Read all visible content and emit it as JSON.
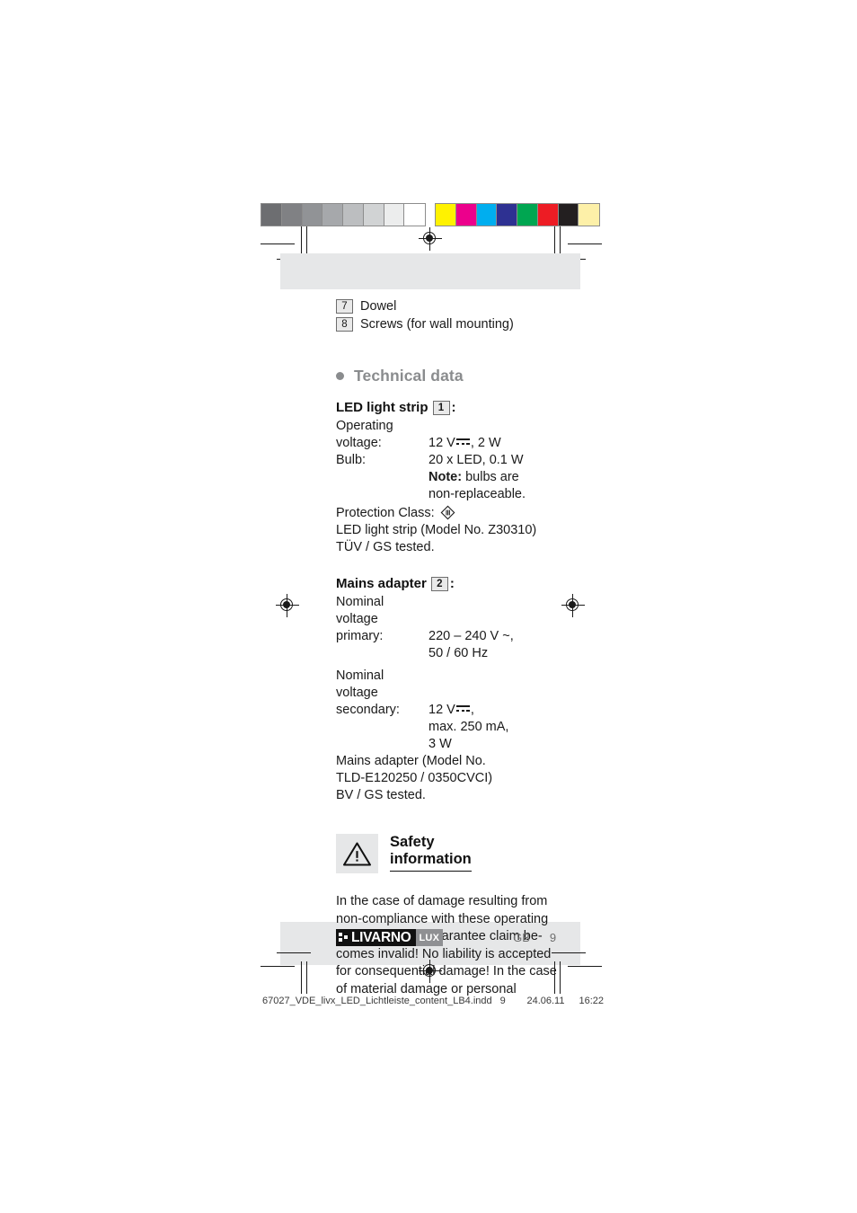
{
  "colorbars": {
    "gray": [
      "#6d6e71",
      "#808184",
      "#919396",
      "#a6a8ab",
      "#bcbec0",
      "#d1d3d4",
      "#eceded",
      "#ffffff"
    ],
    "process": [
      "#fff200",
      "#ec008c",
      "#00aeef",
      "#2e3192",
      "#00a651",
      "#ed1c24",
      "#231f20",
      "#fdf0a8"
    ]
  },
  "parts": [
    {
      "num": "7",
      "label": "Dowel"
    },
    {
      "num": "8",
      "label": "Screws (for wall mounting)"
    }
  ],
  "technical": {
    "heading": "Technical data",
    "led_strip": {
      "title": "LED light strip",
      "num": "1",
      "colon": ":",
      "rows": [
        {
          "label": "Operating",
          "value": ""
        },
        {
          "label": "voltage:",
          "value": "12 V",
          "value_suffix": ", 2 W",
          "dc": true
        },
        {
          "label": "Bulb:",
          "value": "20 x LED, 0.1 W"
        },
        {
          "label": "",
          "value_bold": "Note:",
          "value": " bulbs are"
        },
        {
          "label": "",
          "value": "non-replaceable."
        }
      ],
      "protection_label": "Protection Class:",
      "protection_symbol": "class-III",
      "model_line": "LED light strip (Model No. Z30310)",
      "tested_line": "TÜV / GS tested."
    },
    "mains_adapter": {
      "title": "Mains adapter",
      "num": "2",
      "colon": ":",
      "primary_label_1": "Nominal voltage",
      "primary_label_2": "primary:",
      "primary_value_1": "220 – 240 V ~,",
      "primary_value_2": "50 / 60 Hz",
      "secondary_label_1": "Nominal voltage",
      "secondary_label_2": "secondary:",
      "secondary_value_1": "12 V",
      "secondary_value_1_suffix": ",",
      "secondary_value_2": "max. 250 mA,",
      "secondary_value_3": "3 W",
      "model_line_1": "Mains adapter (Model No.",
      "model_line_2": "TLD-E120250 / 0350CVCI)",
      "tested_line": "BV / GS tested."
    }
  },
  "safety": {
    "icon": "warning-triangle-icon",
    "title_line_1": "Safety",
    "title_line_2": "information",
    "paragraph_lines": [
      "In the case of damage resulting from",
      "non-compliance with these operating",
      "instructions the guarantee claim be-",
      "comes invalid! No liability is accepted",
      "for consequential damage! In the case",
      "of material damage or personal"
    ]
  },
  "footer": {
    "logo_main": "LIVARNO",
    "logo_sub": "LUX",
    "locale": "GB",
    "page_number": "9"
  },
  "print_info": {
    "filename": "67027_VDE_livx_LED_Lichtleiste_content_LB4.indd",
    "page": "9",
    "date": "24.06.11",
    "time": "16:22"
  }
}
